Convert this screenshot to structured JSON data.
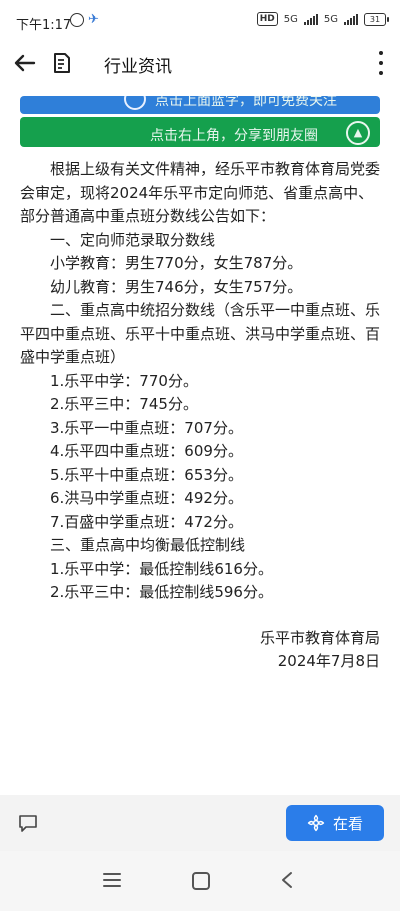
{
  "status_bar": {
    "time": "下午1:17",
    "hd": "HD",
    "signal1": "5G",
    "signal2": "5G",
    "battery": "31"
  },
  "header": {
    "title": "行业资讯"
  },
  "banners": {
    "blue_text": "点击上面蓝字，即可免费关注",
    "green_text": "点击右上角，分享到朋友圈"
  },
  "article": {
    "intro": "根据上级有关文件精神，经乐平市教育体育局党委会审定，现将2024年乐平市定向师范、省重点高中、部分普通高中重点班分数线公告如下：",
    "section1_title": "一、定向师范录取分数线",
    "section1_items": [
      "小学教育：男生770分，女生787分。",
      "幼儿教育：男生746分，女生757分。"
    ],
    "section2_title": "二、重点高中统招分数线（含乐平一中重点班、乐平四中重点班、乐平十中重点班、洪马中学重点班、百盛中学重点班）",
    "section2_items": [
      "1.乐平中学：770分。",
      "2.乐平三中：745分。",
      "3.乐平一中重点班：707分。",
      "4.乐平四中重点班：609分。",
      "5.乐平十中重点班：653分。",
      "6.洪马中学重点班：492分。",
      "7.百盛中学重点班：472分。"
    ],
    "section3_title": "三、重点高中均衡最低控制线",
    "section3_items": [
      "1.乐平中学：最低控制线616分。",
      "2.乐平三中：最低控制线596分。"
    ],
    "signature": "乐平市教育体育局",
    "date": "2024年7月8日"
  },
  "action_bar": {
    "view_label": "在看"
  },
  "colors": {
    "primary": "#2b7de9",
    "banner_blue": "#2f7fd9",
    "banner_green": "#15a04d"
  }
}
